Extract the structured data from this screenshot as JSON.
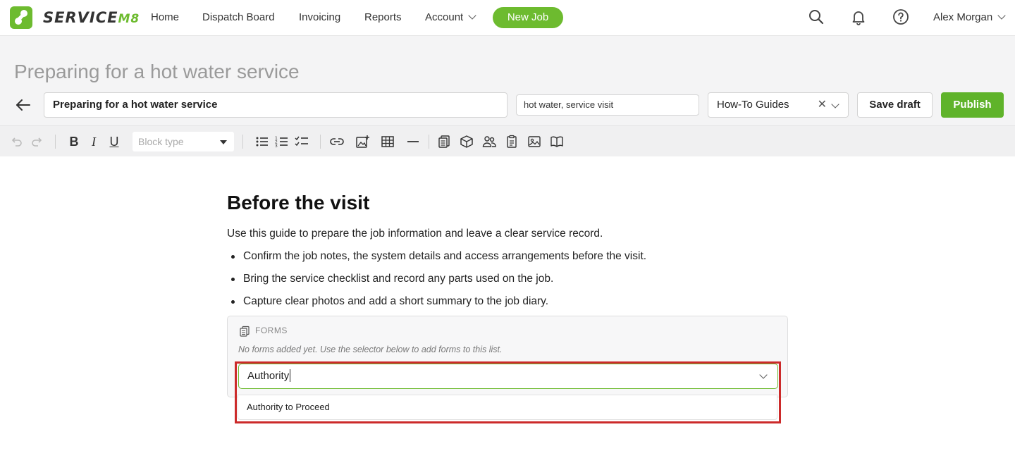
{
  "nav": {
    "brand": "SERVICE",
    "brand_suffix": "M8",
    "items": [
      {
        "label": "Home"
      },
      {
        "label": "Dispatch Board"
      },
      {
        "label": "Invoicing"
      },
      {
        "label": "Reports"
      },
      {
        "label": "Account"
      }
    ],
    "new_job_label": "New Job",
    "user_name": "Alex Morgan",
    "icons": [
      "search-icon",
      "bell-icon",
      "help-icon"
    ]
  },
  "header": {
    "page_title": "Preparing for a hot water service",
    "title_value": "Preparing for a hot water service",
    "tags_value": "hot water, service visit",
    "category_value": "How-To Guides",
    "clear_glyph": "✕",
    "save_draft_label": "Save draft",
    "publish_label": "Publish"
  },
  "toolbar": {
    "block_type_placeholder": "Block type",
    "bold": "B",
    "italic": "I",
    "underline": "U"
  },
  "article": {
    "heading": "Before the visit",
    "intro": "Use this guide to prepare the job information and leave a clear service record.",
    "bullets": [
      "Confirm the job notes, the system details and access arrangements before the visit.",
      "Bring the service checklist and record any parts used on the job.",
      "Capture clear photos and add a short summary to the job diary."
    ]
  },
  "forms_block": {
    "label": "FORMS",
    "empty_text": "No forms added yet. Use the selector below to add forms to this list.",
    "input_value": "Authority",
    "options": [
      "Authority to Proceed"
    ]
  },
  "colors": {
    "brand_green": "#6dbb2f",
    "highlight_red": "#cc2a2a"
  }
}
